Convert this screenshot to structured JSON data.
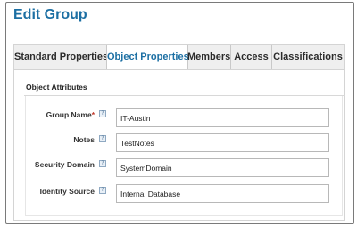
{
  "dialog": {
    "title": "Edit Group"
  },
  "tabs": [
    {
      "label": "Standard Properties"
    },
    {
      "label": "Object Properties",
      "active": true
    },
    {
      "label": "Members"
    },
    {
      "label": "Access"
    },
    {
      "label": "Classifications"
    }
  ],
  "section": {
    "title": "Object Attributes"
  },
  "fields": [
    {
      "label": "Group Name",
      "required_mark": "*",
      "value": "IT-Austin"
    },
    {
      "label": "Notes",
      "value": "TestNotes"
    },
    {
      "label": "Security Domain",
      "value": "SystemDomain"
    },
    {
      "label": "Identity Source",
      "value": "Internal Database"
    }
  ],
  "help_glyph": "?",
  "colors": {
    "accent": "#1c6fa3",
    "required": "#c0392b"
  }
}
